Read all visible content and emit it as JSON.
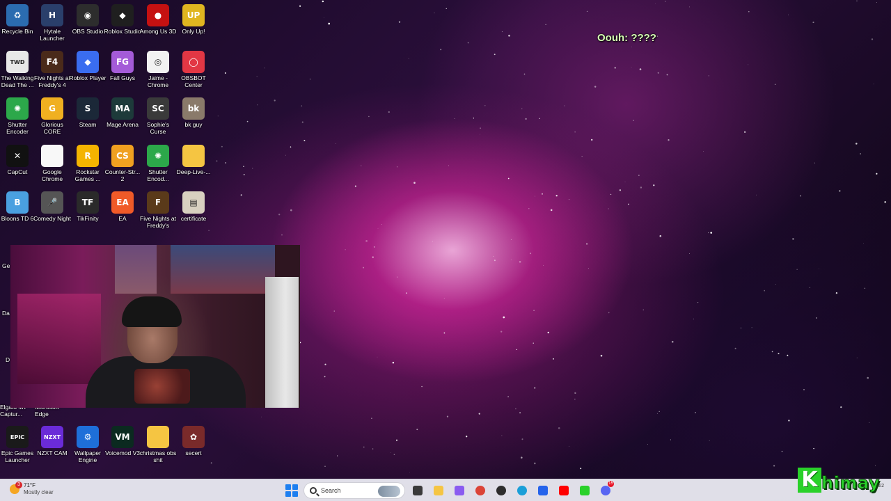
{
  "desktop": {
    "icons": [
      {
        "label": "Recycle Bin",
        "icon": "recycle-bin-icon",
        "color": "#2b6cb0",
        "glyph": "♻"
      },
      {
        "label": "Hytale Launcher",
        "icon": "hytale-icon",
        "color": "#2a3f6b",
        "glyph": "H"
      },
      {
        "label": "OBS Studio",
        "icon": "obs-icon",
        "color": "#2d2d2d",
        "glyph": "◉"
      },
      {
        "label": "Roblox Studio",
        "icon": "roblox-studio-icon",
        "color": "#1f1f1f",
        "glyph": "◆"
      },
      {
        "label": "Among Us 3D",
        "icon": "among-us-icon",
        "color": "#c51111",
        "glyph": "●"
      },
      {
        "label": "Only Up!",
        "icon": "only-up-icon",
        "color": "#e0b520",
        "glyph": "UP"
      },
      {
        "label": "The Walking Dead The ...",
        "icon": "walking-dead-icon",
        "color": "#e8e8e8",
        "glyph": "TWD"
      },
      {
        "label": "Five Nights at Freddy's 4",
        "icon": "fnaf4-icon",
        "color": "#4a2a1a",
        "glyph": "F4"
      },
      {
        "label": "Roblox Player",
        "icon": "roblox-player-icon",
        "color": "#3a6df0",
        "glyph": "◆"
      },
      {
        "label": "Fall Guys",
        "icon": "fall-guys-icon",
        "color": "#a45bd8",
        "glyph": "FG"
      },
      {
        "label": "Jaime - Chrome",
        "icon": "chrome-icon",
        "color": "#f2f2f2",
        "glyph": "◎"
      },
      {
        "label": "OBSBOT Center",
        "icon": "obsbot-icon",
        "color": "#e23744",
        "glyph": "◯"
      },
      {
        "label": "Shutter Encoder",
        "icon": "shutter-encoder-icon",
        "color": "#2ca84a",
        "glyph": "✺"
      },
      {
        "label": "Glorious CORE",
        "icon": "glorious-icon",
        "color": "#f0b020",
        "glyph": "G"
      },
      {
        "label": "Steam",
        "icon": "steam-icon",
        "color": "#1b2838",
        "glyph": "S"
      },
      {
        "label": "Mage Arena",
        "icon": "mage-arena-icon",
        "color": "#1d3a3a",
        "glyph": "MA"
      },
      {
        "label": "Sophie's Curse",
        "icon": "sophies-curse-icon",
        "color": "#3a3a3a",
        "glyph": "SC"
      },
      {
        "label": "bk guy",
        "icon": "bk-guy-icon",
        "color": "#8a7a6a",
        "glyph": "bk"
      },
      {
        "label": "CapCut",
        "icon": "capcut-icon",
        "color": "#111111",
        "glyph": "✕"
      },
      {
        "label": "Google Chrome",
        "icon": "file-icon",
        "color": "#f8f8f8",
        "glyph": ""
      },
      {
        "label": "Rockstar Games ...",
        "icon": "rockstar-icon",
        "color": "#f4b400",
        "glyph": "R"
      },
      {
        "label": "Counter-Str... 2",
        "icon": "cs2-icon",
        "color": "#f0a020",
        "glyph": "CS"
      },
      {
        "label": "Shutter Encod...",
        "icon": "shutter-encoder-icon",
        "color": "#2ca84a",
        "glyph": "✺"
      },
      {
        "label": "Deep-Live-...",
        "icon": "folder-icon",
        "color": "#f5c542",
        "glyph": ""
      },
      {
        "label": "Bloons TD 6",
        "icon": "bloons-icon",
        "color": "#4aa0e0",
        "glyph": "B"
      },
      {
        "label": "Comedy Night",
        "icon": "comedy-night-icon",
        "color": "#555555",
        "glyph": "🎤"
      },
      {
        "label": "TikFinity",
        "icon": "tikfinity-icon",
        "color": "#2a2a2a",
        "glyph": "TF"
      },
      {
        "label": "EA",
        "icon": "ea-icon",
        "color": "#f05a28",
        "glyph": "EA"
      },
      {
        "label": "Five Nights at Freddy's",
        "icon": "fnaf-icon",
        "color": "#5a3a1a",
        "glyph": "F"
      },
      {
        "label": "certificate",
        "icon": "certificate-icon",
        "color": "#d8d0c0",
        "glyph": "▤"
      },
      {
        "label": "Epic Games Launcher",
        "icon": "epic-games-icon",
        "color": "#1a1a1a",
        "glyph": "EPIC"
      },
      {
        "label": "NZXT CAM",
        "icon": "nzxt-icon",
        "color": "#6a2bd8",
        "glyph": "NZXT"
      },
      {
        "label": "Wallpaper Engine",
        "icon": "wallpaper-engine-icon",
        "color": "#1e6fd9",
        "glyph": "⚙"
      },
      {
        "label": "Voicemod V3",
        "icon": "voicemod-icon",
        "color": "#0b2a20",
        "glyph": "VM"
      },
      {
        "label": "christmas obs shit",
        "icon": "folder-icon",
        "color": "#f5c542",
        "glyph": ""
      },
      {
        "label": "secert",
        "icon": "secert-icon",
        "color": "#7a2a2a",
        "glyph": "✿"
      }
    ],
    "partial_labels": {
      "r6_left": "Ge",
      "r7_left": "Da",
      "r8_left": "D",
      "r9_col1": "Elgato 4K Captur...",
      "r9_col2": "Microsoft Edge"
    }
  },
  "overlay": {
    "chat_text": "Oouh: ????"
  },
  "taskbar": {
    "weather_temp": "71°F",
    "weather_condition": "Mostly clear",
    "weather_badge": "3",
    "search_placeholder": "Search",
    "date_text": "4/3/2",
    "apps": [
      {
        "name": "task-view-icon",
        "color": "#3a3a3a"
      },
      {
        "name": "file-explorer-icon",
        "color": "#f5c542"
      },
      {
        "name": "copilot-icon",
        "color": "#8a5cf0"
      },
      {
        "name": "chrome-icon",
        "color": "#db4437"
      },
      {
        "name": "obs-icon",
        "color": "#2d2d2d"
      },
      {
        "name": "edge-icon",
        "color": "#1a9fd8"
      },
      {
        "name": "microsoft-store-icon",
        "color": "#2563eb"
      },
      {
        "name": "youtube-icon",
        "color": "#ff0000"
      },
      {
        "name": "kick-icon",
        "color": "#2ad12a"
      },
      {
        "name": "discord-icon",
        "color": "#5865f2"
      }
    ],
    "discord_badge": "15"
  },
  "watermark": {
    "letter": "K",
    "rest": "himay"
  }
}
